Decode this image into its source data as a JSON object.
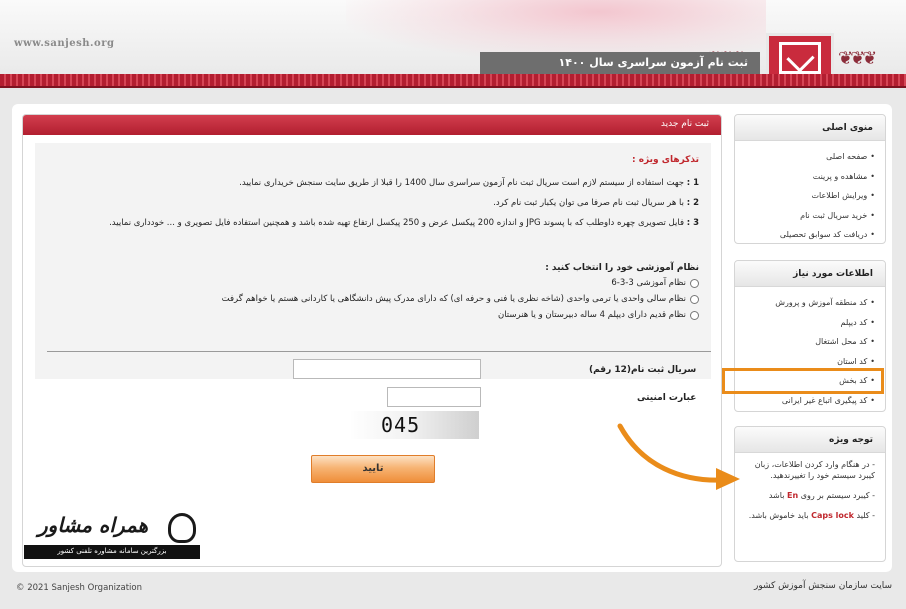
{
  "header": {
    "site_url": "www.sanjesh.org",
    "title": "ثبت نام آزمون سراسری سال ۱۴۰۰"
  },
  "main": {
    "panel_title": "ثبت نام جدید",
    "notes_title": "تذکرهای ویژه :",
    "notes": [
      {
        "num": "1 :",
        "text": "جهت استفاده از سیستم لازم است سریال ثبت نام آزمون سراسری سال 1400 را قبلا از طریق سایت سنجش خریداری نمایید."
      },
      {
        "num": "2 :",
        "text": "با هر سریال ثبت نام صرفا می توان یکبار ثبت نام کرد."
      },
      {
        "num": "3 :",
        "text": "فایل تصویری چهره داوطلب که با پسوند JPG و اندازه 200 پیکسل عرض و 250 پیکسل ارتفاع تهیه شده باشد و همچنین استفاده فایل تصویری و ... خودداری نمایید."
      }
    ],
    "choose_title": "نظام آموزشی خود را انتخاب کنید :",
    "options": [
      "نظام آموزشی 3-3-6",
      "نظام سالی واحدی یا ترمی واحدی (شاخه نظری یا فنی و حرفه ای) که دارای مدرک پیش دانشگاهی یا کاردانی هستم یا خواهم گرفت",
      "نظام قدیم دارای دیپلم 4 ساله دبیرستان و یا هنرستان"
    ],
    "serial_label": "سریال ثبت نام(12 رقم)",
    "serial_value": "",
    "security_label": "عبارت امنیتی",
    "security_value": "",
    "captcha_text": "045",
    "submit_label": "تایید"
  },
  "sidebar": {
    "menu_title": "منوی اصلی",
    "menu_items": [
      "صفحه اصلی",
      "مشاهده و پرینت",
      "ویرایش اطلاعات",
      "خرید سریال ثبت نام",
      "دریافت کد سوابق تحصیلی"
    ],
    "info_title": "اطلاعات مورد نیاز",
    "info_items": [
      "کد منطقه آموزش و پرورش",
      "کد دیپلم",
      "کد محل اشتغال",
      "کد استان",
      "کد بخش",
      "کد پیگیری اتباع غیر ایرانی"
    ],
    "special_title": "توجه ویژه",
    "special_notes": [
      "- در هنگام وارد کردن اطلاعات، زبان کیبرد سیستم خود را تغییرندهید.",
      "- کیبرد سیستم بر روی",
      "- کلید",
      "باید خاموش باشد."
    ],
    "special_en": "En",
    "special_en_after": "باشد",
    "special_caps": "Caps lock"
  },
  "footer": {
    "copyright": "© 2021 Sanjesh Organization",
    "org_name": "سایت سازمان سنجش آموزش کشور"
  },
  "watermark": {
    "title": "همراه مشاور",
    "subtitle": "بزرگترین سامانه مشاوره تلفنی کشور"
  },
  "colors": {
    "accent_red": "#b21f30",
    "highlight_orange": "#ea8c1a",
    "button_orange": "#ef8e3a"
  }
}
